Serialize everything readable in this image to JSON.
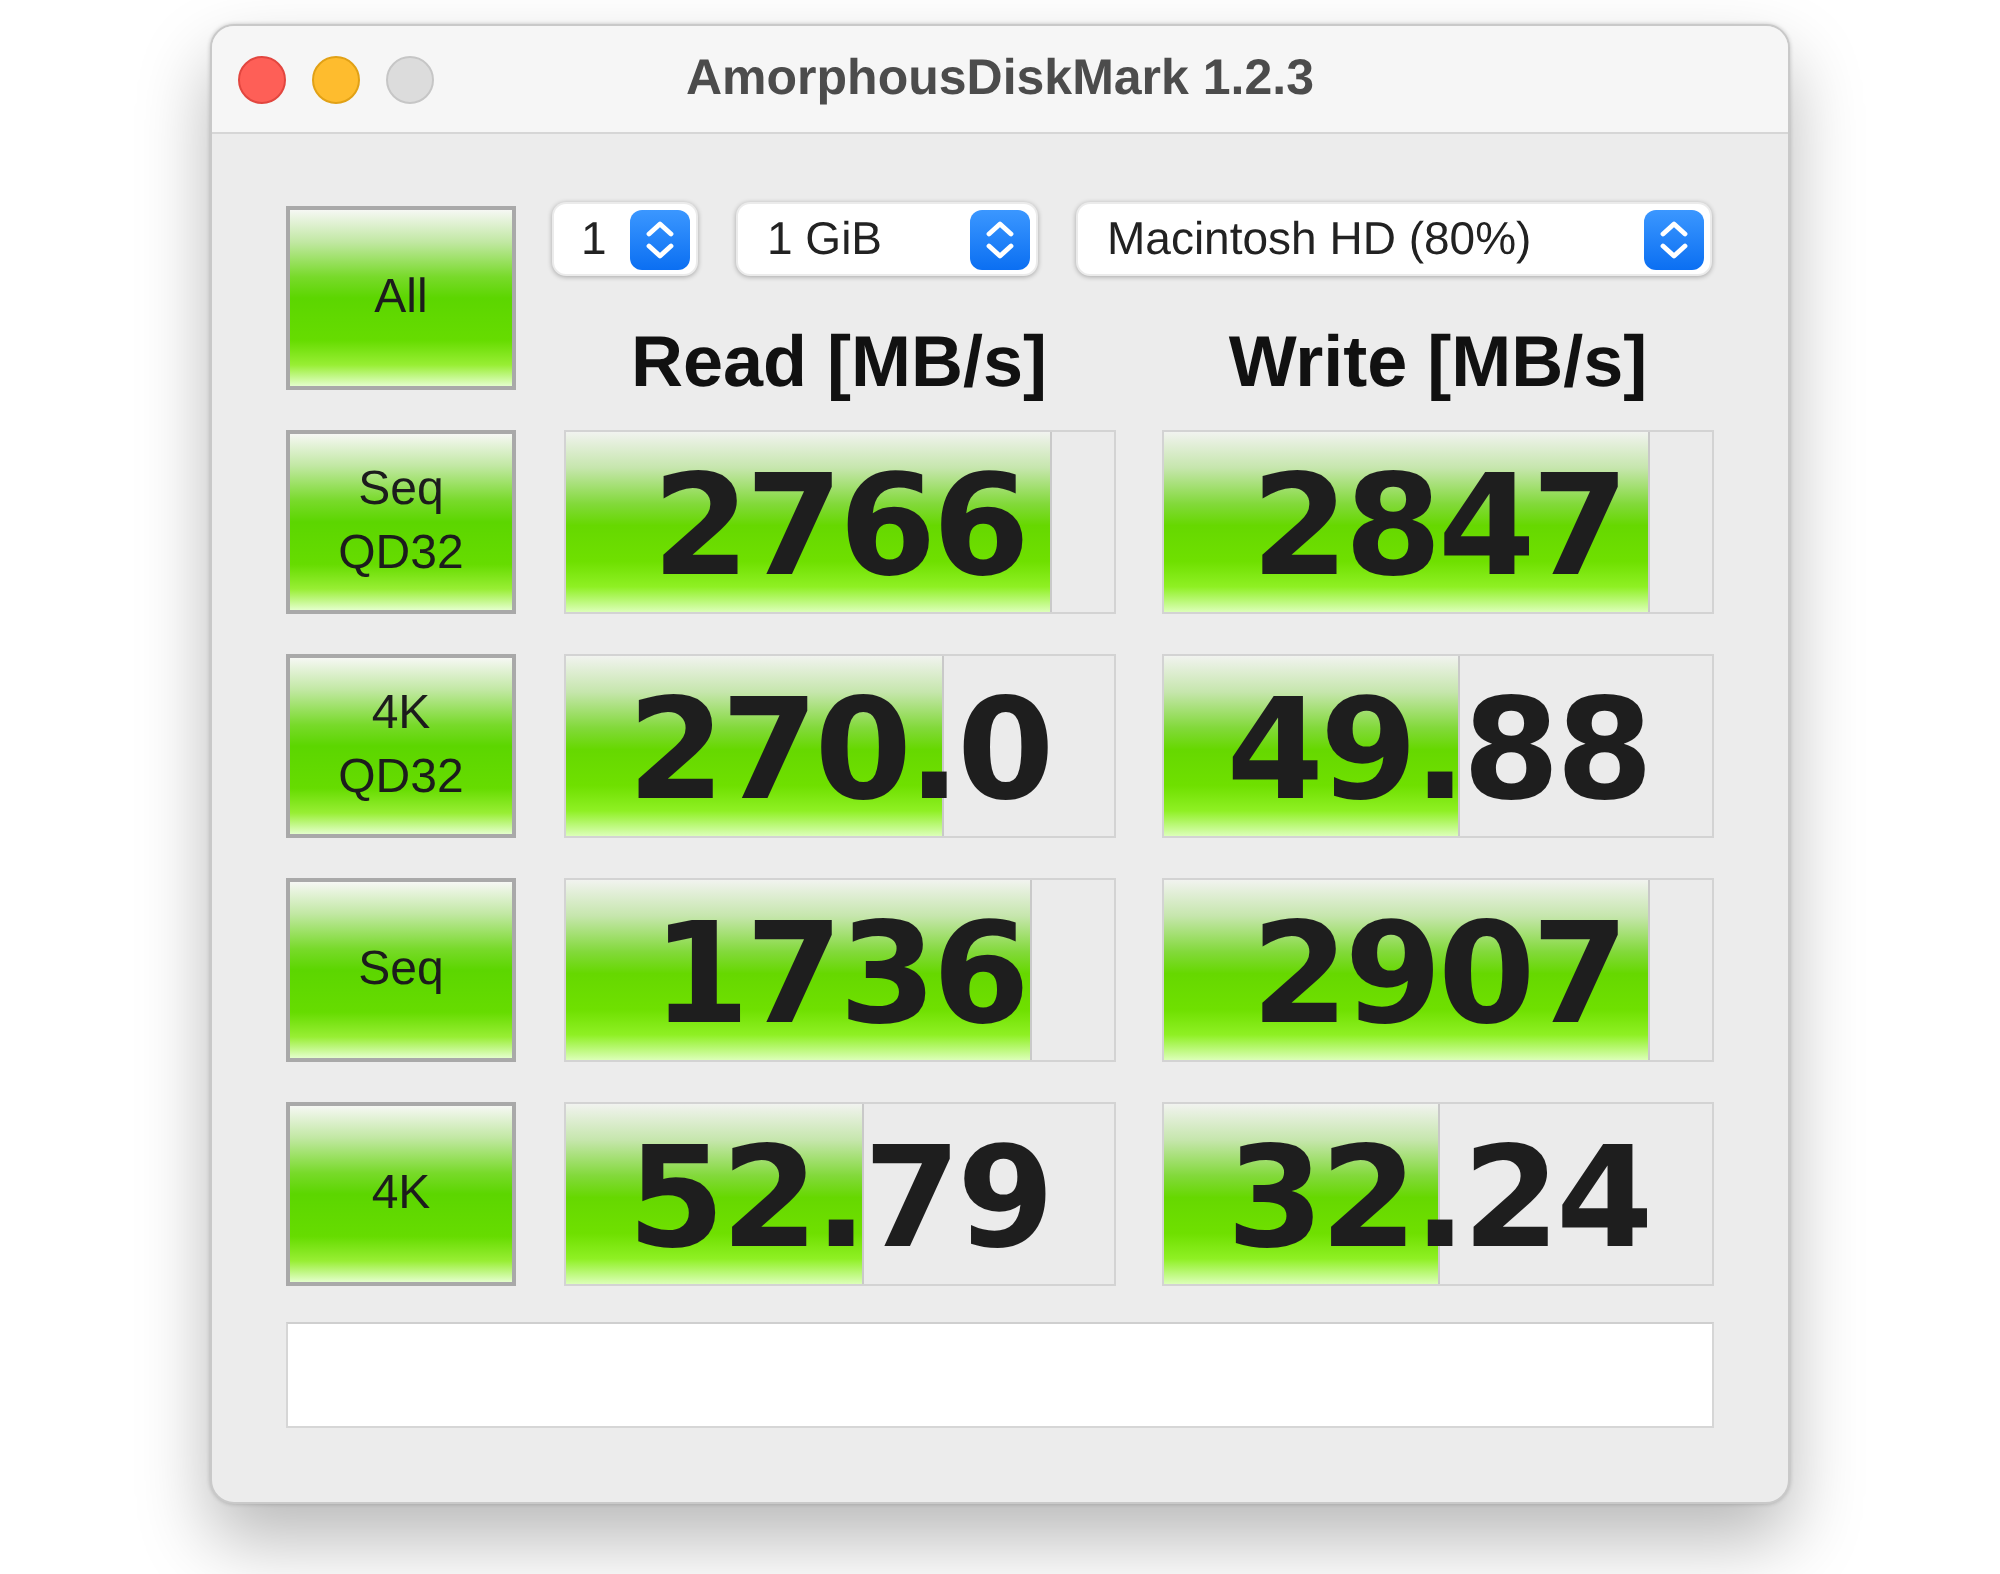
{
  "window": {
    "title": "AmorphousDiskMark 1.2.3",
    "zoom_disabled": true
  },
  "all_button": {
    "label": "All"
  },
  "selectors": [
    {
      "value": "1"
    },
    {
      "value": "1 GiB"
    },
    {
      "value": "Macintosh HD (80%)"
    }
  ],
  "columns": [
    {
      "label": "Read [MB/s]"
    },
    {
      "label": "Write [MB/s]"
    }
  ],
  "tests": [
    {
      "label": "Seq QD32",
      "read": {
        "value": "2766",
        "level": 0.888
      },
      "write": {
        "value": "2847",
        "level": 0.888
      }
    },
    {
      "label": "4K QD32",
      "read": {
        "value": "270.0",
        "level": 0.692
      },
      "write": {
        "value": "49.88",
        "level": 0.54
      }
    },
    {
      "label": "Seq",
      "read": {
        "value": "1736",
        "level": 0.851
      },
      "write": {
        "value": "2907",
        "level": 0.888
      }
    },
    {
      "label": "4K",
      "read": {
        "value": "52.79",
        "level": 0.547
      },
      "write": {
        "value": "32.24",
        "level": 0.504
      }
    }
  ]
}
